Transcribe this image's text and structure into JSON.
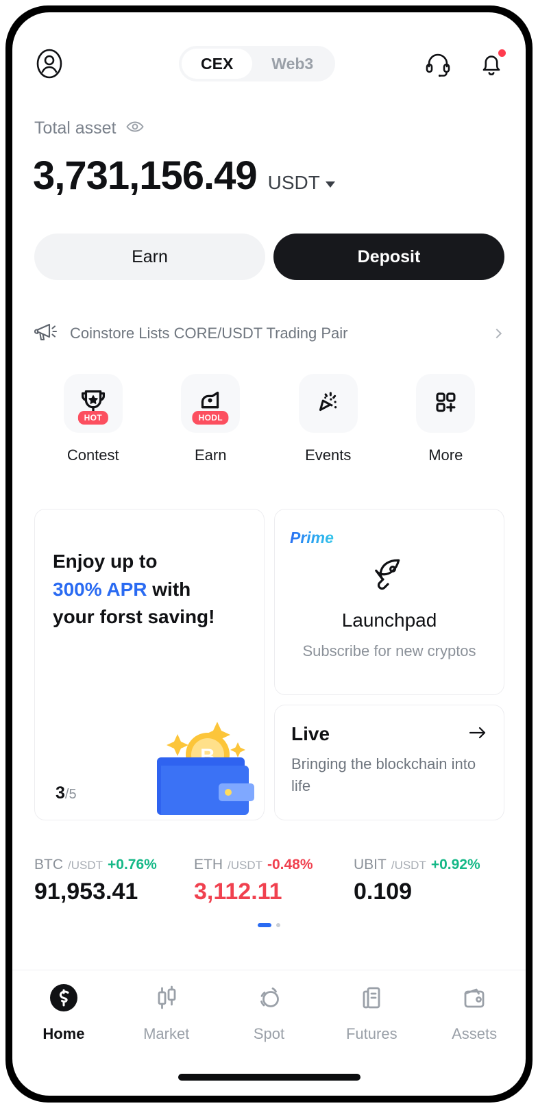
{
  "header": {
    "profile_icon": "user-circle-icon",
    "tabs": [
      {
        "label": "CEX",
        "active": true
      },
      {
        "label": "Web3",
        "active": false
      }
    ],
    "support_icon": "headset-icon",
    "notification_icon": "bell-icon",
    "has_notification_dot": true
  },
  "balance": {
    "label": "Total asset",
    "eye_icon": "eye-icon",
    "amount": "3,731,156.49",
    "currency": "USDT"
  },
  "actions": {
    "earn_label": "Earn",
    "deposit_label": "Deposit"
  },
  "announcement": {
    "icon": "megaphone-icon",
    "text": "Coinstore Lists CORE/USDT Trading Pair",
    "chevron": "chevron-right-icon"
  },
  "quick_actions": [
    {
      "label": "Contest",
      "icon": "trophy-icon",
      "badge": "HOT"
    },
    {
      "label": "Earn",
      "icon": "piggy-bank-icon",
      "badge": "HODL"
    },
    {
      "label": "Events",
      "icon": "confetti-icon",
      "badge": ""
    },
    {
      "label": "More",
      "icon": "grid-plus-icon",
      "badge": ""
    }
  ],
  "promo_card": {
    "line1": "Enjoy up to",
    "highlight": "300% APR",
    "line2_rest": " with",
    "line3": "your forst saving!",
    "highlight_color": "#2a6bf2",
    "counter_current": "3",
    "counter_total": "/5",
    "art": "wallet-bitcoin-icon"
  },
  "prime_card": {
    "tag": "Prime",
    "icon": "rocket-icon",
    "title": "Launchpad",
    "subtitle": "Subscribe for new cryptos"
  },
  "live_card": {
    "title": "Live",
    "arrow_icon": "arrow-right-icon",
    "subtitle": "Bringing the blockchain into life"
  },
  "tickers": [
    {
      "base": "BTC",
      "quote": "/USDT",
      "change": "+0.76%",
      "direction": "up",
      "price": "91,953.41"
    },
    {
      "base": "ETH",
      "quote": "/USDT",
      "change": "-0.48%",
      "direction": "down",
      "price": "3,112.11"
    },
    {
      "base": "UBIT",
      "quote": "/USDT",
      "change": "+0.92%",
      "direction": "up",
      "price": "0.109"
    }
  ],
  "pagination": {
    "active_index": 0,
    "count": 2
  },
  "bottom_nav": [
    {
      "label": "Home",
      "icon": "coinstore-logo-icon",
      "active": true
    },
    {
      "label": "Market",
      "icon": "candlestick-icon",
      "active": false
    },
    {
      "label": "Spot",
      "icon": "spot-swap-icon",
      "active": false
    },
    {
      "label": "Futures",
      "icon": "contract-document-icon",
      "active": false
    },
    {
      "label": "Assets",
      "icon": "wallet-icon",
      "active": false
    }
  ],
  "colors": {
    "accent_blue": "#2a6bf2",
    "up_green": "#15b887",
    "down_red": "#f0414f",
    "badge_red": "#fc4f5f",
    "primary_dark": "#17181c"
  }
}
